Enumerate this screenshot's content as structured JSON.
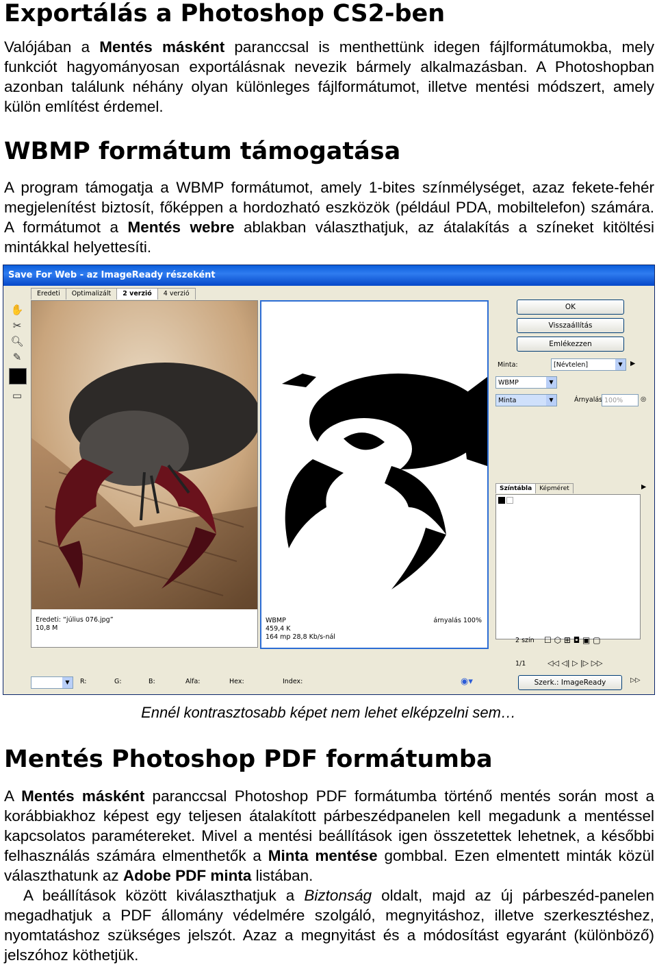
{
  "heading1": "Exportálás a Photoshop CS2-ben",
  "p1": {
    "a": "Valójában a ",
    "b": "Mentés másként",
    "c": " paranccsal is menthettünk idegen fájlformátumokba, mely funkciót hagyományosan exportálásnak nevezik bármely alkalmazásban. A Photoshopban azonban találunk néhány olyan különleges fájlformátumot, illetve mentési módszert, amely külön említést érdemel."
  },
  "heading2": "WBMP formátum támogatása",
  "p2": {
    "a": "A program támogatja a WBMP formátumot, amely 1-bites színmélységet, azaz fekete-fehér megjelenítést biztosít, főképpen a hordozható eszközök (például PDA, mobiltelefon) számára. A formátumot a ",
    "b": "Mentés webre",
    "c": " ablakban választhatjuk, az átalakítás a színeket kitöltési mintákkal helyettesíti."
  },
  "dialog": {
    "title": "Save For Web - az ImageReady részeként",
    "tabs": [
      "Eredeti",
      "Optimalizált",
      "2 verzió",
      "4 verzió"
    ],
    "buttons": {
      "ok": "OK",
      "reset": "Visszaállítás",
      "remember": "Emlékezzen"
    },
    "preset_label": "Minta:",
    "preset_value": "[Névtelen]",
    "format_value": "WBMP",
    "dither_value": "Minta",
    "amount_label": "Árnyalás:",
    "amount_value": "100%",
    "panel_tabs": [
      "Színtábla",
      "Képméret"
    ],
    "colors_count": "2 szín",
    "left_info": {
      "line1": "Eredeti: “július 076.jpg”",
      "line2": "10,8 M"
    },
    "right_info": {
      "line1": "WBMP",
      "line2": "459,4 K",
      "line3": "164 mp 28,8 Kb/s-nál",
      "dither": "árnyalás 100%"
    },
    "page_indicator": "1/1",
    "status": {
      "r": "R:",
      "g": "G:",
      "b": "B:",
      "alpha": "Alfa:",
      "hex": "Hex:",
      "index": "Index:"
    },
    "edit_in": "Szerk.: ImageReady"
  },
  "caption": "Ennél kontrasztosabb képet nem lehet elképzelni sem…",
  "heading3": "Mentés Photoshop PDF formátumba",
  "p3": {
    "a": "A ",
    "b": "Mentés másként",
    "c": " paranccsal Photoshop PDF formátumba történő mentés során most a korábbiakhoz képest egy teljesen átalakított párbeszédpanelen kell megadunk a mentéssel kapcsolatos paramétereket. Mivel a mentési beállítások igen összetettek lehetnek, a későbbi felhasználás számára elmenthetők a ",
    "d": "Minta mentése",
    "e": " gombbal. Ezen elmentett minták közül választhatunk az ",
    "f": "Adobe PDF minta",
    "g": " listában."
  },
  "p4": {
    "a": "A beállítások között kiválaszthatjuk a ",
    "b": "Biztonság",
    "c": " oldalt, majd az új párbeszéd-panelen megadhatjuk a PDF állomány védelmére szolgáló, megnyitáshoz, illetve szerkesztéshez, nyomtatáshoz szükséges jelszót. Azaz a megnyitást és a módosítást egyaránt (különböző) jelszóhoz köthetjük."
  }
}
